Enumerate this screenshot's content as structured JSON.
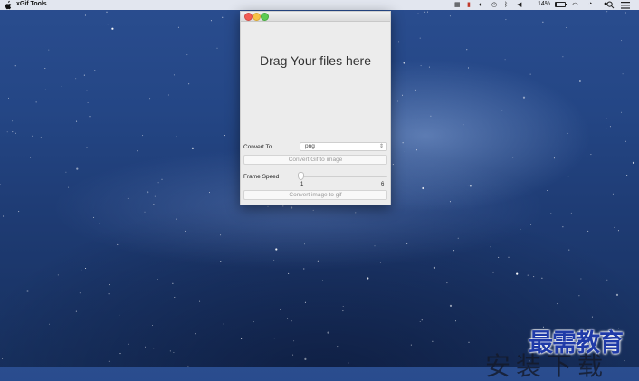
{
  "menubar": {
    "app_title": "xGif Tools",
    "status_icons": [
      "status-app-icon",
      "flag-icon",
      "sync-icon",
      "history-icon",
      "bluetooth-icon",
      "volume-icon"
    ],
    "battery_percent": "14%",
    "battery_level": 0.14,
    "right_icons": [
      "wifi-icon",
      "clock-icon",
      "user-icon",
      "search-icon",
      "menu-list-icon"
    ]
  },
  "window": {
    "drop_text": "Drag Your files here",
    "convert_to_label": "Convert To",
    "format_select_value": "png",
    "convert_gif_button": "Convert Gif to image",
    "frame_speed_label": "Frame Speed",
    "frame_speed_value": 1,
    "frame_speed_min": "1",
    "frame_speed_max": "6",
    "convert_image_button": "Convert image to gif"
  },
  "watermark": {
    "main": "最需教育",
    "sub": "安装下载"
  },
  "colors": {
    "wallpaper": "#244685",
    "close": "#f25c54",
    "minimize": "#f7c247",
    "maximize": "#5ccb53",
    "watermark": "#1f3aa8"
  }
}
